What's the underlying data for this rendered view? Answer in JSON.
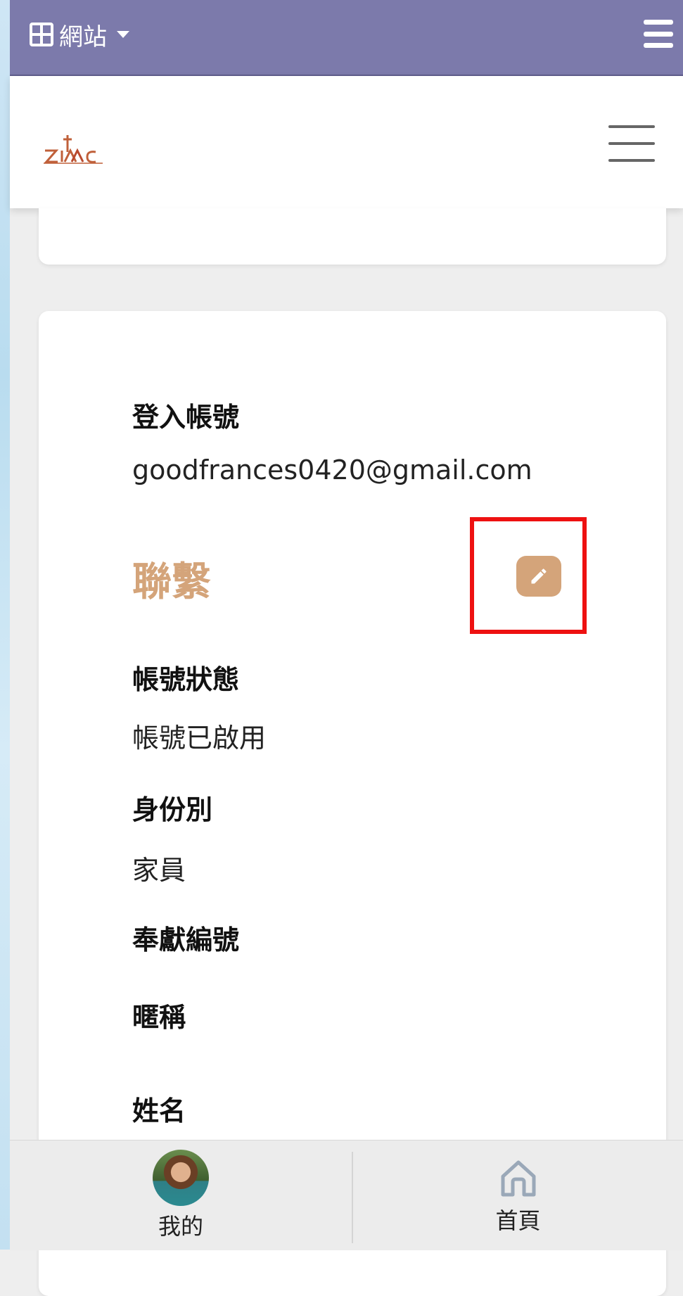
{
  "topbar": {
    "site_label": "網站",
    "icons": {
      "site": "grid-icon",
      "caret": "caret-down-icon",
      "menu": "hamburger-menu-icon"
    },
    "background": "#7c7aab"
  },
  "header": {
    "logo_icon": "zitac-logo",
    "menu_icon": "hamburger-menu-icon"
  },
  "profile": {
    "login_account_label": "登入帳號",
    "login_account_value": "goodfrances0420@gmail.com",
    "section_title": "聯繫",
    "edit_icon": "pencil-icon",
    "account_status_label": "帳號狀態",
    "account_status_value": "帳號已啟用",
    "identity_label": "身份別",
    "identity_value": "家員",
    "offering_number_label": "奉獻編號",
    "nickname_label": "暱稱",
    "name_label": "姓名"
  },
  "bottom_nav": {
    "items": [
      {
        "label": "我的",
        "icon": "avatar"
      },
      {
        "label": "首頁",
        "icon": "home-icon"
      }
    ]
  },
  "colors": {
    "accent": "#d4a47a",
    "highlight": "#ee1111",
    "page_bg": "#eeeeee"
  }
}
